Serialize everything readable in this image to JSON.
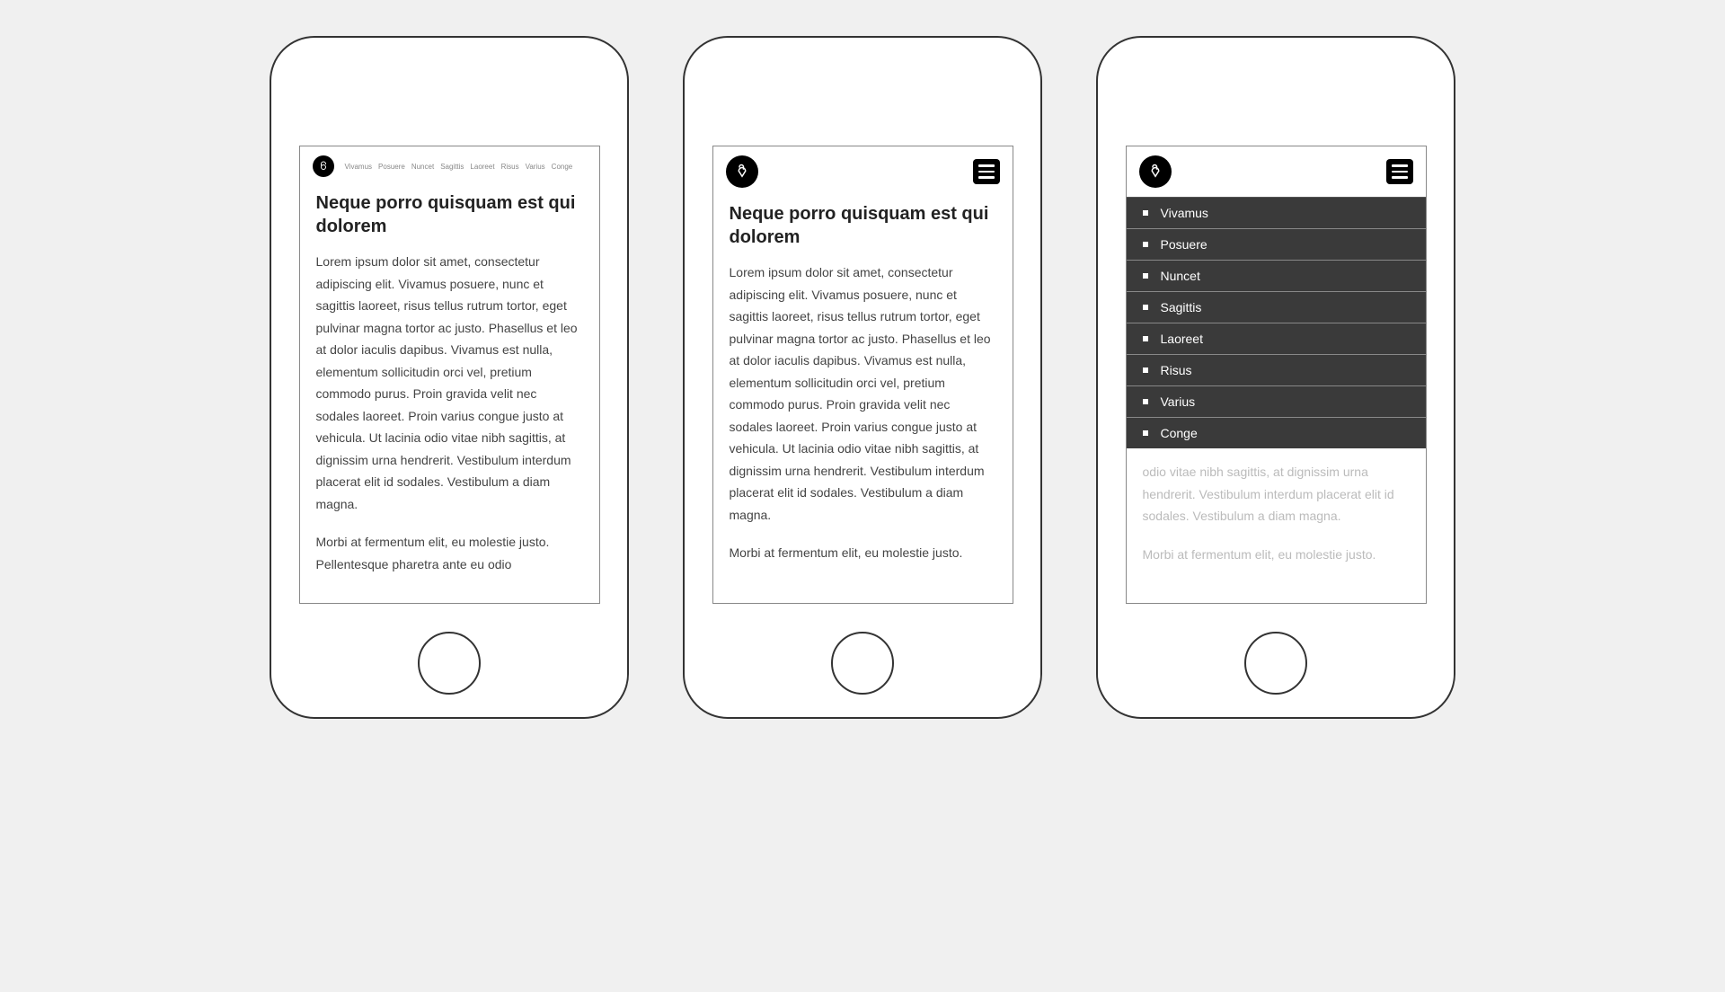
{
  "nav_items": [
    "Vivamus",
    "Posuere",
    "Nuncet",
    "Sagittis",
    "Laoreet",
    "Risus",
    "Varius",
    "Conge"
  ],
  "article": {
    "title": "Neque porro quisquam est qui dolorem",
    "p1": "Lorem ipsum dolor sit amet, consectetur adipiscing elit. Vivamus posuere, nunc et sagittis laoreet, risus tellus rutrum tortor, eget pulvinar magna tortor ac justo. Phasellus et leo at dolor iaculis dapibus. Vivamus est nulla, elementum sollicitudin orci vel, pretium commodo purus. Proin gravida velit nec sodales laoreet. Proin varius congue justo at vehicula. Ut lacinia odio vitae nibh sagittis, at dignissim urna hendrerit. Vestibulum interdum placerat elit id sodales. Vestibulum a diam magna.",
    "p2": "Morbi at fermentum elit, eu molestie justo. Pellentesque pharetra ante eu odio"
  },
  "phone2": {
    "p2": "Morbi at fermentum elit, eu molestie justo."
  },
  "phone3": {
    "bg_p1": "odio vitae nibh sagittis, at dignissim urna hendrerit. Vestibulum interdum placerat elit id sodales. Vestibulum a diam magna.",
    "bg_p2": "Morbi at fermentum elit, eu molestie justo."
  }
}
